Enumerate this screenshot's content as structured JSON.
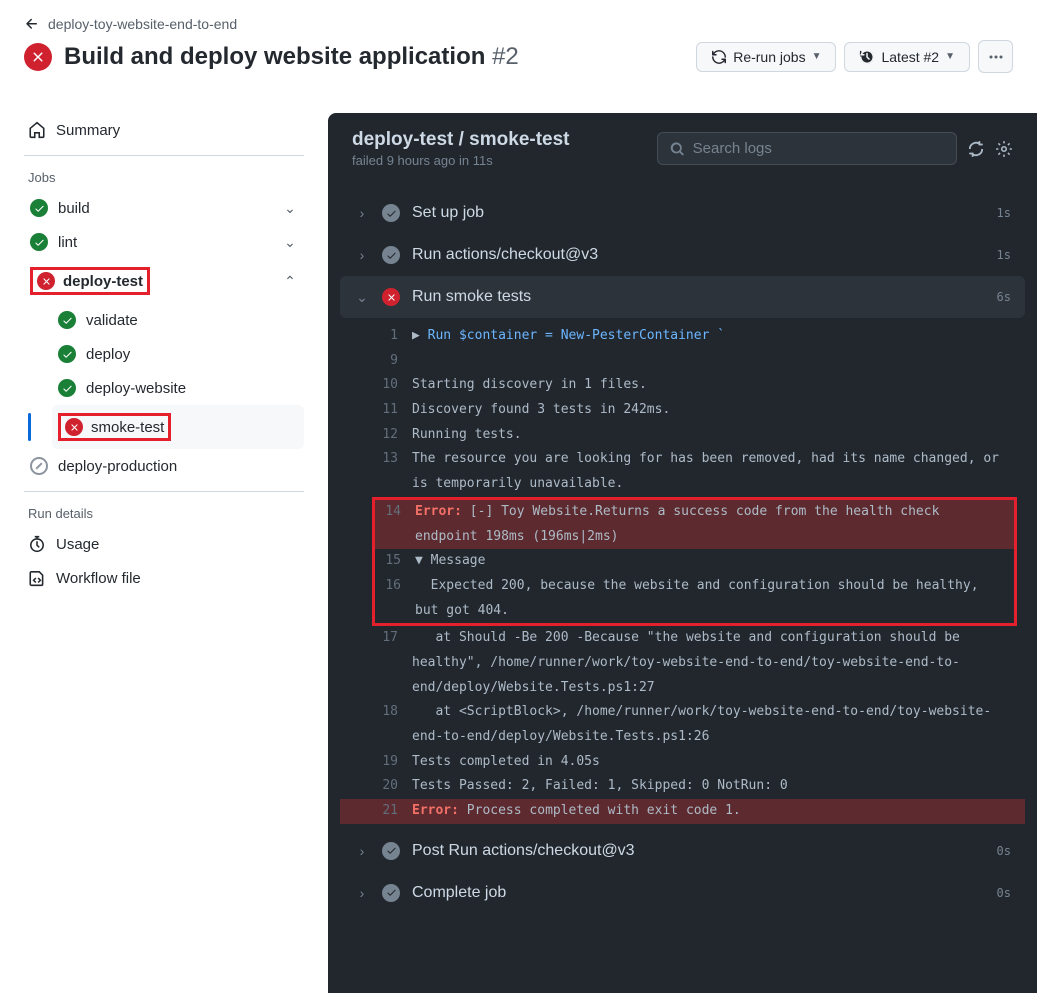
{
  "breadcrumb": "deploy-toy-website-end-to-end",
  "title": "Build and deploy website application",
  "run_number": "#2",
  "actions": {
    "rerun": "Re-run jobs",
    "latest": "Latest #2"
  },
  "sidebar": {
    "summary": "Summary",
    "jobs_label": "Jobs",
    "jobs": [
      {
        "name": "build",
        "status": "success",
        "expandable": true
      },
      {
        "name": "lint",
        "status": "success",
        "expandable": true
      },
      {
        "name": "deploy-test",
        "status": "fail",
        "expandable": true,
        "expanded": true,
        "highlight": true
      },
      {
        "name": "deploy-production",
        "status": "skip",
        "expandable": false
      }
    ],
    "deploy_test_children": [
      {
        "name": "validate",
        "status": "success"
      },
      {
        "name": "deploy",
        "status": "success"
      },
      {
        "name": "deploy-website",
        "status": "success"
      },
      {
        "name": "smoke-test",
        "status": "fail",
        "selected": true,
        "highlight": true
      }
    ],
    "run_details_label": "Run details",
    "usage": "Usage",
    "workflow_file": "Workflow file"
  },
  "log": {
    "title": "deploy-test / smoke-test",
    "subtitle": "failed 9 hours ago in 11s",
    "search_placeholder": "Search logs",
    "steps": [
      {
        "name": "Set up job",
        "status": "neutral",
        "time": "1s",
        "expanded": false
      },
      {
        "name": "Run actions/checkout@v3",
        "status": "neutral",
        "time": "1s",
        "expanded": false
      },
      {
        "name": "Run smoke tests",
        "status": "fail",
        "time": "6s",
        "expanded": true
      },
      {
        "name": "Post Run actions/checkout@v3",
        "status": "neutral",
        "time": "0s",
        "expanded": false
      },
      {
        "name": "Complete job",
        "status": "neutral",
        "time": "0s",
        "expanded": false
      }
    ],
    "lines": [
      {
        "n": "1",
        "type": "cmd",
        "text": "Run $container = New-PesterContainer `"
      },
      {
        "n": "9",
        "type": "plain",
        "text": ""
      },
      {
        "n": "10",
        "type": "plain",
        "text": "Starting discovery in 1 files."
      },
      {
        "n": "11",
        "type": "plain",
        "text": "Discovery found 3 tests in 242ms."
      },
      {
        "n": "12",
        "type": "plain",
        "text": "Running tests."
      },
      {
        "n": "13",
        "type": "plain",
        "text": "The resource you are looking for has been removed, had its name changed, or is temporarily unavailable."
      },
      {
        "n": "14",
        "type": "error",
        "text": "[-] Toy Website.Returns a success code from the health check endpoint 198ms (196ms|2ms)",
        "hl": true,
        "bg": true
      },
      {
        "n": "15",
        "type": "collapse",
        "text": "Message",
        "hl": true
      },
      {
        "n": "16",
        "type": "plain",
        "text": "  Expected 200, because the website and configuration should be healthy, but got 404.",
        "hl": true
      },
      {
        "n": "17",
        "type": "plain",
        "text": "   at Should -Be 200 -Because \"the website and configuration should be healthy\", /home/runner/work/toy-website-end-to-end/toy-website-end-to-end/deploy/Website.Tests.ps1:27"
      },
      {
        "n": "18",
        "type": "plain",
        "text": "   at <ScriptBlock>, /home/runner/work/toy-website-end-to-end/toy-website-end-to-end/deploy/Website.Tests.ps1:26"
      },
      {
        "n": "19",
        "type": "plain",
        "text": "Tests completed in 4.05s"
      },
      {
        "n": "20",
        "type": "plain",
        "text": "Tests Passed: 2, Failed: 1, Skipped: 0 NotRun: 0"
      },
      {
        "n": "21",
        "type": "error",
        "text": "Process completed with exit code 1.",
        "bg": true
      }
    ]
  }
}
